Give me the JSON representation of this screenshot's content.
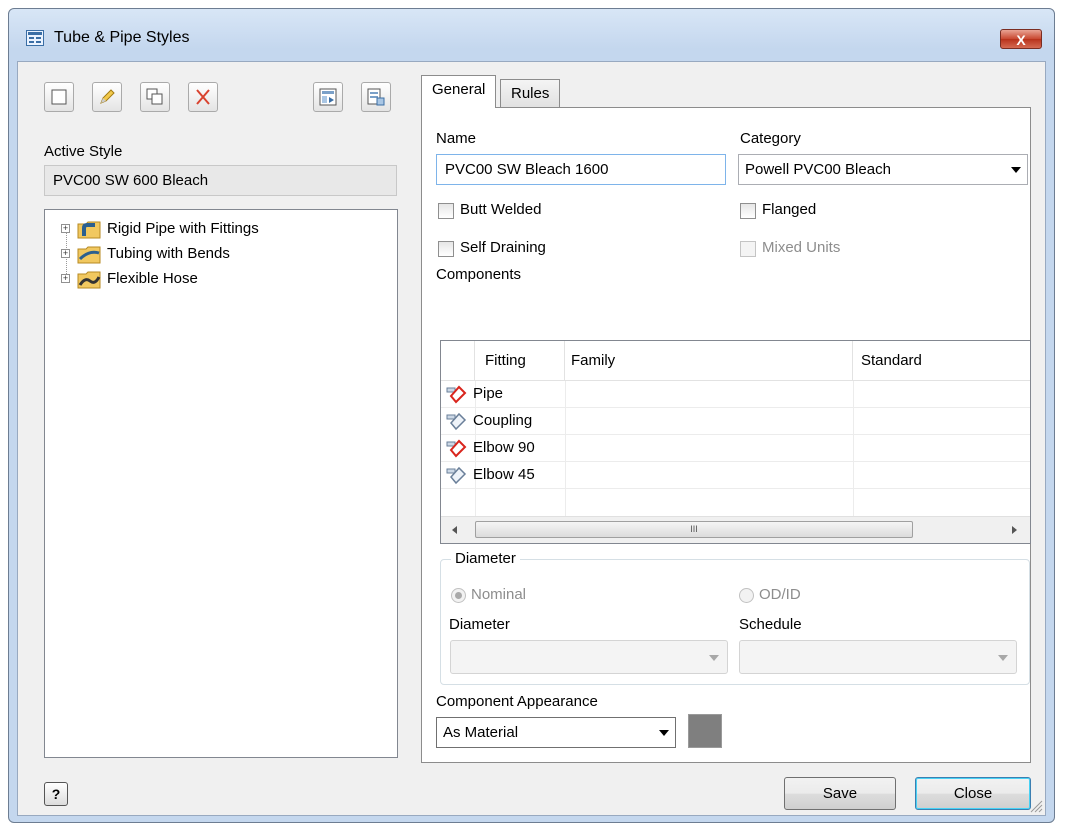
{
  "window": {
    "title": "Tube & Pipe Styles",
    "close_glyph": "X"
  },
  "toolbar": {
    "icons": [
      "new-style-icon",
      "edit-style-icon",
      "copy-style-icon",
      "delete-style-icon",
      "import-icon",
      "export-icon"
    ]
  },
  "active_style": {
    "label": "Active Style",
    "value": "PVC00 SW 600 Bleach"
  },
  "tree": {
    "items": [
      {
        "label": "Rigid Pipe with Fittings",
        "icon": "rigid-pipe-folder-icon",
        "expander": "+"
      },
      {
        "label": "Tubing with Bends",
        "icon": "tubing-folder-icon",
        "expander": "+"
      },
      {
        "label": "Flexible Hose",
        "icon": "flexible-hose-folder-icon",
        "expander": "+"
      }
    ]
  },
  "tabs": {
    "general": "General",
    "rules": "Rules"
  },
  "general": {
    "name_label": "Name",
    "name_value": "PVC00 SW Bleach 1600",
    "category_label": "Category",
    "category_value": "Powell PVC00 Bleach",
    "butt_welded": "Butt Welded",
    "flanged": "Flanged",
    "self_draining": "Self Draining",
    "mixed_units": "Mixed Units",
    "components_label": "Components",
    "columns": {
      "fitting": "Fitting",
      "family": "Family",
      "standard": "Standard"
    },
    "rows": [
      {
        "name": "Pipe",
        "status": "missing"
      },
      {
        "name": "Coupling",
        "status": "ok"
      },
      {
        "name": "Elbow 90",
        "status": "missing"
      },
      {
        "name": "Elbow 45",
        "status": "ok"
      }
    ],
    "scroll_grip": "III",
    "diameter_group": "Diameter",
    "nominal": "Nominal",
    "odid": "OD/ID",
    "diameter_label": "Diameter",
    "schedule_label": "Schedule",
    "appearance_label": "Component Appearance",
    "appearance_value": "As Material",
    "swatch_color": "#7f7f7f"
  },
  "buttons": {
    "save": "Save",
    "close": "Close",
    "help": "?"
  }
}
